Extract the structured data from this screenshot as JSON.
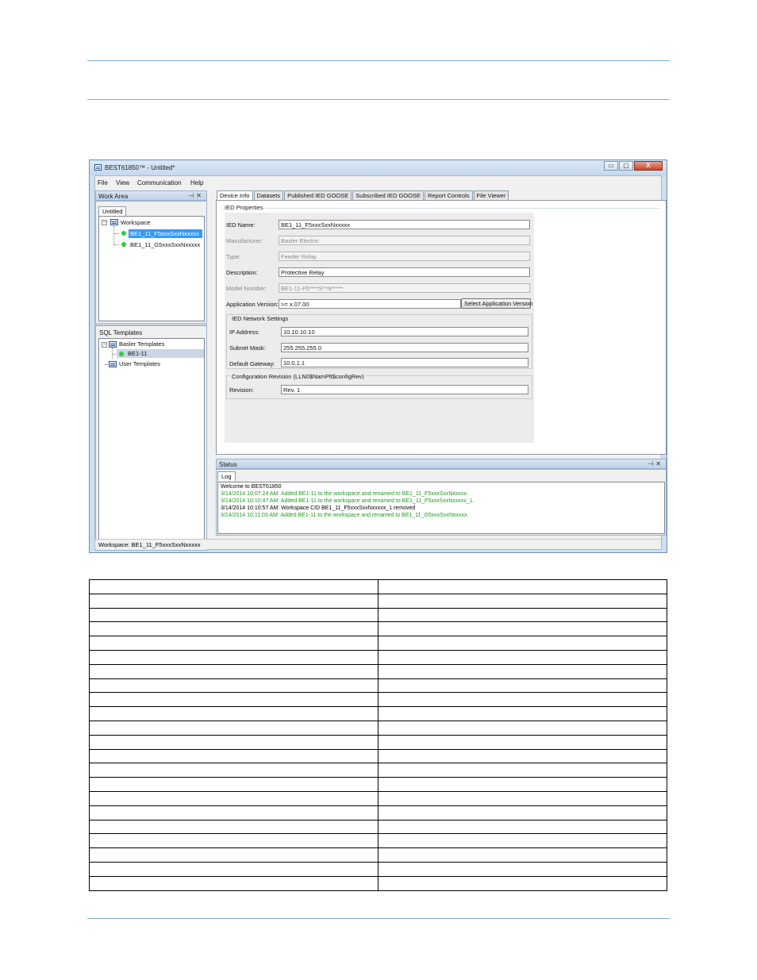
{
  "window": {
    "title": "BEST61850™ - Untitled*",
    "buttons": {
      "minimize": "▭",
      "maximize": "▢",
      "close": "X"
    }
  },
  "menu": [
    "File",
    "View",
    "Communication",
    "Help"
  ],
  "work_area": {
    "title": "Work Area",
    "pin": "⊣",
    "close": "✕",
    "tab": "Untitled",
    "tree": {
      "root": "Workspace",
      "children": [
        "BE1_11_F5xxxSxxNxxxxx",
        "BE1_11_G5xxxSxxNxxxxx"
      ]
    }
  },
  "sql_templates": {
    "title": "SQL Templates",
    "tree": {
      "basler": "Basler Templates",
      "basler_child": "BE1-11",
      "user": "User Templates"
    }
  },
  "tabs": [
    "Device Info",
    "Datasets",
    "Published IED GOOSE",
    "Subscribed IED GOOSE",
    "Report Controls",
    "File Viewer"
  ],
  "ied_properties": {
    "group_title": "IED Properties",
    "ied_name": {
      "label": "IED Name:",
      "value": "BE1_11_F5xxxSxxNxxxxx"
    },
    "manufacturer": {
      "label": "Manufacturer:",
      "value": "Basler Electric"
    },
    "type": {
      "label": "Type:",
      "value": "Feeder Relay"
    },
    "description": {
      "label": "Description:",
      "value": "Protective Relay"
    },
    "model_number": {
      "label": "Model Number:",
      "value": "BE1-11-F5****S**N*****"
    },
    "app_version": {
      "label": "Application Version:",
      "value": ">= x.07.00",
      "button": "Select Application Version"
    }
  },
  "network": {
    "group_title": "IED Network Settings",
    "ip": {
      "label": "IP Address:",
      "value": "10.10.10.10"
    },
    "subnet": {
      "label": "Subnet Mask:",
      "value": "255.255.255.0"
    },
    "gateway": {
      "label": "Default Gateway:",
      "value": "10.0.1.1"
    }
  },
  "config_rev": {
    "group_title": "Configuration Revision (LLN0$NamPlt$configRev)",
    "revision": {
      "label": "Revision:",
      "value": "Rev. 1"
    }
  },
  "status": {
    "title": "Status",
    "pin": "⊣",
    "close": "✕",
    "tab": "Log",
    "log": [
      {
        "text": "Welcome to BEST61850",
        "color": "#000000"
      },
      {
        "text": "3/14/2014 10:07:24 AM: Added BE1-11 to the workspace and renamed to BE1_11_F5xxxSxxNxxxxx.",
        "color": "#1f9a1f"
      },
      {
        "text": "3/14/2014 10:10:47 AM: Added BE1-11 to the workspace and renamed to BE1_11_F5xxxSxxNxxxxx_1.",
        "color": "#1f9a1f"
      },
      {
        "text": "3/14/2014 10:10:57 AM: Workspace CID BE1_11_F5xxxSxxNxxxxx_1 removed",
        "color": "#000000"
      },
      {
        "text": "3/14/2014 10:11:03 AM: Added BE1-11 to the workspace and renamed to BE1_11_G5xxxSxxNxxxxx.",
        "color": "#1f9a1f"
      }
    ]
  },
  "statusbar": "Workspace: BE1_11_F5xxxSxxNxxxxx",
  "table": {
    "rows": 22,
    "cols": 2
  }
}
